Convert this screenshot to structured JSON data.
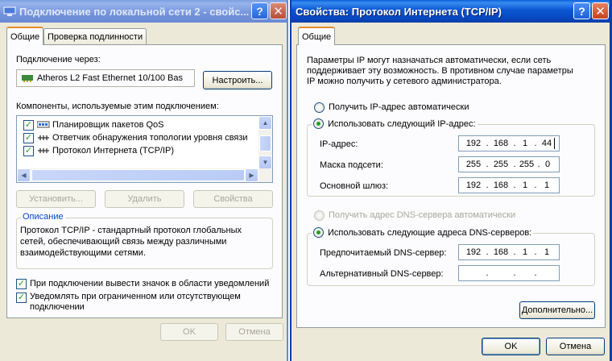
{
  "left_window": {
    "title": "Подключение по локальной сети 2 - свойс...",
    "help_glyph": "?",
    "close_glyph": "✕",
    "tabs": [
      "Общие",
      "Проверка подлинности"
    ],
    "connect_via_label": "Подключение через:",
    "adapter_name": "Atheros L2 Fast Ethernet 10/100 Bas",
    "configure_button": "Настроить...",
    "components_label": "Компоненты, используемые этим подключением:",
    "components": [
      {
        "label": "Планировщик пакетов QoS",
        "checked": true,
        "icon": "qos-icon"
      },
      {
        "label": "Ответчик обнаружения топологии уровня связи",
        "checked": true,
        "icon": "network-protocol-icon"
      },
      {
        "label": "Протокол Интернета (TCP/IP)",
        "checked": true,
        "icon": "network-protocol-icon"
      }
    ],
    "install_button": "Установить...",
    "remove_button": "Удалить",
    "properties_button": "Свойства",
    "description_legend": "Описание",
    "description_text": [
      "Протокол TCP/IP - стандартный протокол глобальных",
      "сетей, обеспечивающий связь между различными",
      "взаимодействующими сетями."
    ],
    "notify_icon_label": "При подключении вывести значок в области уведомлений",
    "notify_limited_label": [
      "Уведомлять при ограниченном или отсутствующем",
      "подключении"
    ],
    "ok_button": "OK",
    "cancel_button": "Отмена"
  },
  "right_window": {
    "title": "Свойства: Протокол Интернета (TCP/IP)",
    "help_glyph": "?",
    "close_glyph": "✕",
    "tab": "Общие",
    "intro_text": [
      "Параметры IP могут назначаться автоматически, если сеть",
      "поддерживает эту возможность. В противном случае параметры",
      "IP можно получить у сетевого администратора."
    ],
    "auto_ip_label": "Получить IP-адрес автоматически",
    "manual_ip_label": "Использовать следующий IP-адрес:",
    "ip_address_label": "IP-адрес:",
    "ip_address": [
      "192",
      "168",
      "1",
      "44"
    ],
    "subnet_label": "Маска подсети:",
    "subnet_mask": [
      "255",
      "255",
      "255",
      "0"
    ],
    "gateway_label": "Основной шлюз:",
    "gateway": [
      "192",
      "168",
      "1",
      "1"
    ],
    "auto_dns_label": "Получить адрес DNS-сервера автоматически",
    "manual_dns_label": "Использовать следующие адреса DNS-серверов:",
    "preferred_dns_label": "Предпочитаемый DNS-сервер:",
    "preferred_dns": [
      "192",
      "168",
      "1",
      "1"
    ],
    "alternate_dns_label": "Альтернативный DNS-сервер:",
    "alternate_dns": [
      "",
      "",
      "",
      ""
    ],
    "dot": ".",
    "advanced_button": "Дополнительно...",
    "ok_button": "OK",
    "cancel_button": "Отмена"
  },
  "colors": {
    "active_title": "#0a56d0",
    "inactive_title": "#7593dc",
    "dialog_bg": "#ece9d8",
    "tab_highlight": "#e68b2c"
  }
}
